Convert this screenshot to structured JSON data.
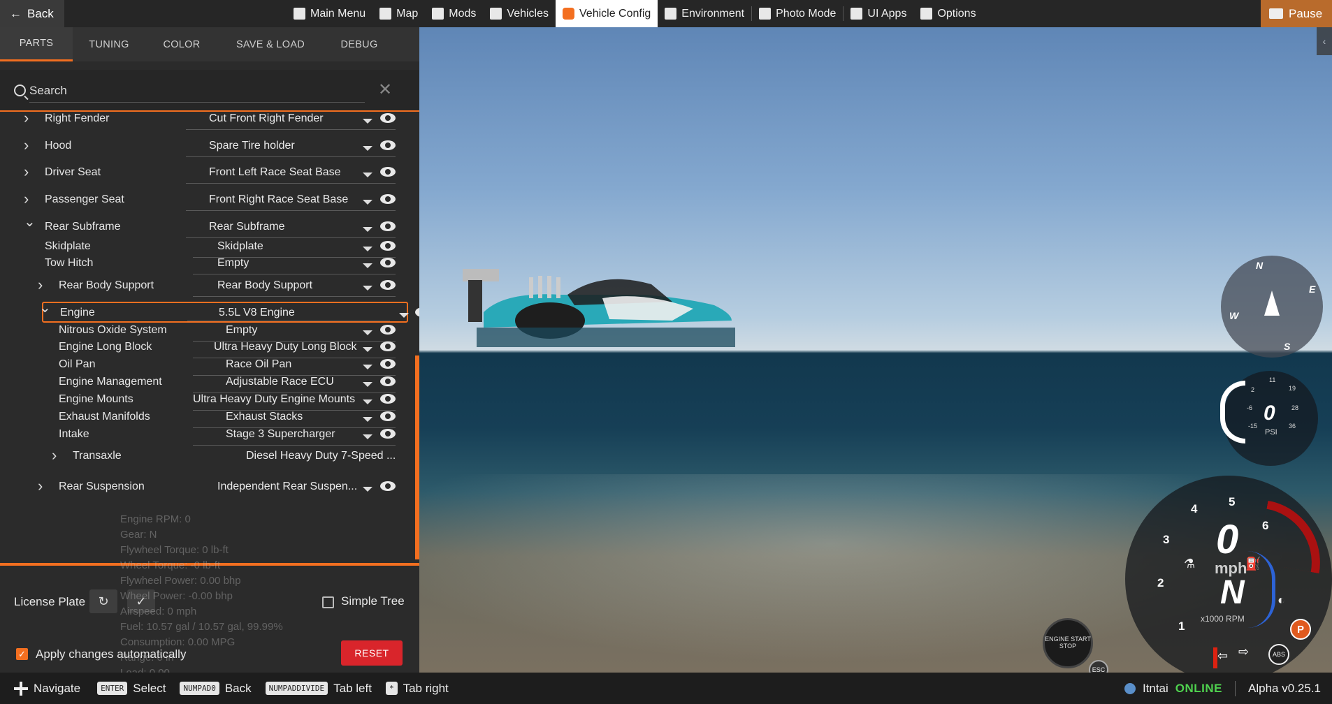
{
  "topbar": {
    "back_label": "Back",
    "pause_label": "Pause",
    "nav": [
      {
        "label": "Main Menu",
        "icon": "menu-icon"
      },
      {
        "label": "Map",
        "icon": "map-icon"
      },
      {
        "label": "Mods",
        "icon": "puzzle-icon"
      },
      {
        "label": "Vehicles",
        "icon": "car-icon"
      },
      {
        "label": "Vehicle Config",
        "icon": "engine-icon",
        "active": true
      },
      {
        "label": "Environment",
        "icon": "weather-icon"
      },
      {
        "label": "Photo Mode",
        "icon": "camera-icon"
      },
      {
        "label": "UI Apps",
        "icon": "apps-icon"
      },
      {
        "label": "Options",
        "icon": "sliders-icon"
      }
    ]
  },
  "tabs": [
    "PARTS",
    "TUNING",
    "COLOR",
    "SAVE & LOAD",
    "DEBUG"
  ],
  "search": {
    "placeholder": "Search"
  },
  "parts": [
    {
      "label": "Right Fender",
      "value": "Cut Front Right Fender",
      "chevron": "right"
    },
    {
      "label": "Hood",
      "value": "Spare Tire holder",
      "chevron": "right"
    },
    {
      "label": "Driver Seat",
      "value": "Front Left Race Seat Base",
      "chevron": "right"
    },
    {
      "label": "Passenger Seat",
      "value": "Front Right Race Seat Base",
      "chevron": "right"
    },
    {
      "label": "Rear Subframe",
      "value": "Rear Subframe",
      "chevron": "down"
    },
    {
      "label": "Skidplate",
      "value": "Skidplate",
      "chevron": ""
    },
    {
      "label": "Tow Hitch",
      "value": "Empty",
      "chevron": ""
    },
    {
      "label": "Rear Body Support",
      "value": "Rear Body Support",
      "chevron": "right"
    },
    {
      "label": "Engine",
      "value": "5.5L V8 Engine",
      "chevron": "down",
      "highlight": true
    },
    {
      "label": "Nitrous Oxide System",
      "value": "Empty",
      "chevron": ""
    },
    {
      "label": "Engine Long Block",
      "value": "Ultra Heavy Duty Long Block",
      "chevron": ""
    },
    {
      "label": "Oil Pan",
      "value": "Race Oil Pan",
      "chevron": ""
    },
    {
      "label": "Engine Management",
      "value": "Adjustable Race ECU",
      "chevron": ""
    },
    {
      "label": "Engine Mounts",
      "value": "Ultra Heavy Duty Engine Mounts",
      "chevron": ""
    },
    {
      "label": "Exhaust Manifolds",
      "value": "Exhaust Stacks",
      "chevron": ""
    },
    {
      "label": "Intake",
      "value": "Stage 3 Supercharger",
      "chevron": ""
    },
    {
      "label": "Transaxle",
      "value": "Diesel Heavy Duty 7-Speed ...",
      "chevron": "right"
    },
    {
      "label": "Rear Suspension",
      "value": "Independent Rear Suspen...",
      "chevron": "right"
    }
  ],
  "telemetry": [
    "Engine RPM: 0",
    "Gear: N",
    "Flywheel Torque: 0 lb-ft",
    "Wheel Torque: -0 lb-ft",
    "Flywheel Power: 0.00 bhp",
    "Wheel Power: -0.00 bhp",
    "Airspeed: 0 mph",
    "Fuel: 10.57 gal / 10.57 gal, 99.99%",
    "Consumption: 0.00 MPG",
    "Range: 0 in",
    "Load: 0.00"
  ],
  "footer": {
    "license_plate_label": "License Plate",
    "simple_tree_label": "Simple Tree",
    "simple_tree_checked": false,
    "apply_label": "Apply changes automatically",
    "apply_checked": true,
    "reset_label": "RESET"
  },
  "hud": {
    "compass": [
      "N",
      "E",
      "S",
      "W"
    ],
    "boost_value": "0",
    "boost_unit": "PSI",
    "boost_ticks": [
      "2",
      "-6",
      "-15",
      "11",
      "19",
      "28",
      "36"
    ],
    "speed": "0",
    "speed_unit": "mph",
    "gear": "N",
    "rpm_unit": "x1000 RPM",
    "rpm_ticks": [
      "1",
      "2",
      "3",
      "4",
      "5",
      "6"
    ],
    "ignition_label": "ENGINE START STOP",
    "esc_label": "ESC",
    "park_label": "P",
    "abs_label": "ABS"
  },
  "bottombar": {
    "hints": [
      {
        "key": "",
        "label": "Navigate"
      },
      {
        "key": "ENTER",
        "label": "Select"
      },
      {
        "key": "NUMPAD0",
        "label": "Back"
      },
      {
        "key": "NUMPADDIVIDE",
        "label": "Tab left"
      },
      {
        "key": "*",
        "label": "Tab right"
      }
    ],
    "user": "Itntai",
    "status": "ONLINE",
    "version": "Alpha v0.25.1"
  }
}
